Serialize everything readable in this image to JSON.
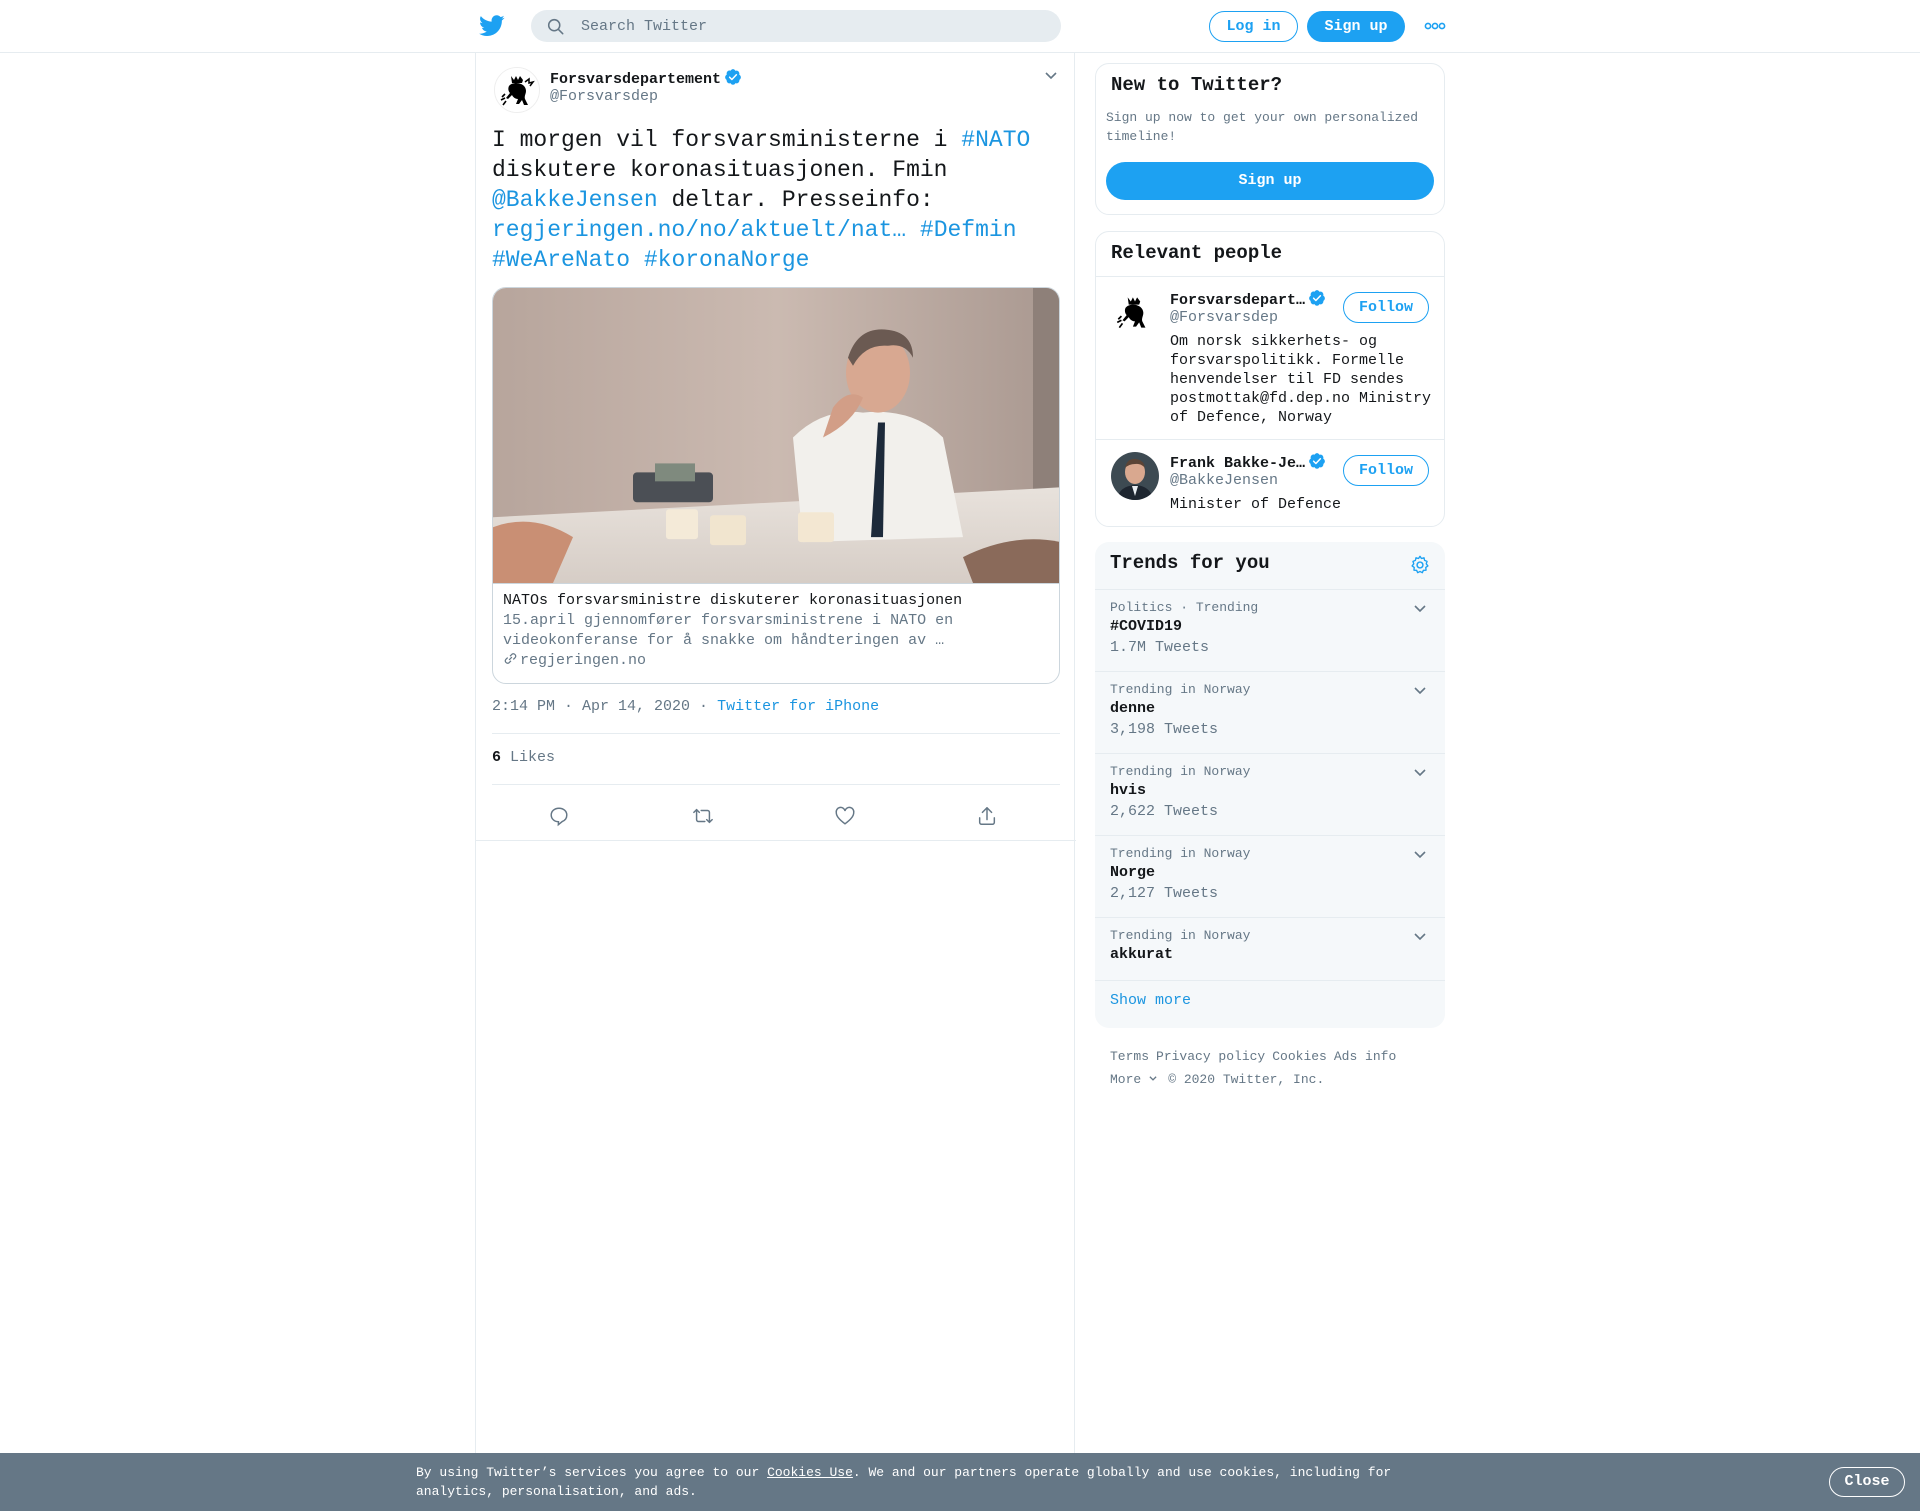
{
  "header": {
    "search_placeholder": "Search Twitter",
    "login_label": "Log in",
    "signup_label": "Sign up",
    "logo_icon": "twitter-bird-icon",
    "more_icon": "more-dots-icon",
    "brand_color": "#1da1f2"
  },
  "tweet": {
    "author_name": "Forsvarsdepartement",
    "author_handle": "@Forsvarsdep",
    "text_parts": {
      "t1": "I morgen vil forsvarsministerne i ",
      "nato": "#NATO",
      "t2": " diskutere koronasituasjonen. Fmin ",
      "mention": "@BakkeJensen",
      "t3": " deltar. Presseinfo: ",
      "link": "regjeringen.no/no/aktuelt/nat…",
      "defmin": "#Defmin",
      "wearenato": "#WeAreNato",
      "korona": "#koronaNorge"
    },
    "card": {
      "title": "NATOs forsvarsministre diskuterer koronasituasjonen",
      "description": "15.april gjennomfører forsvarsministrene i NATO en videokonferanse for å snakke om håndteringen av …",
      "domain": "regjeringen.no"
    },
    "time": "2:14 PM · Apr 14, 2020",
    "sep": " · ",
    "source": "Twitter for iPhone",
    "likes_count": "6",
    "likes_label": "Likes"
  },
  "sidebar": {
    "new_title": "New to Twitter?",
    "new_subtitle": "Sign up now to get your own personalized timeline!",
    "signup_label": "Sign up",
    "relevant_title": "Relevant people",
    "people": [
      {
        "name": "Forsvarsdepart…",
        "handle": "@Forsvarsdep",
        "bio": "Om norsk sikkerhets- og forsvarspolitikk. Formelle henvendelser til FD sendes postmottak@fd.dep.no Ministry of Defence, Norway",
        "follow_label": "Follow"
      },
      {
        "name": "Frank Bakke-Je…",
        "handle": "@BakkeJensen",
        "bio": "Minister of Defence",
        "follow_label": "Follow"
      }
    ],
    "trends_title": "Trends for you",
    "trends": [
      {
        "context": "Politics · Trending",
        "name": "#COVID19",
        "count": "1.7M Tweets"
      },
      {
        "context": "Trending in Norway",
        "name": "denne",
        "count": "3,198 Tweets"
      },
      {
        "context": "Trending in Norway",
        "name": "hvis",
        "count": "2,622 Tweets"
      },
      {
        "context": "Trending in Norway",
        "name": "Norge",
        "count": "2,127 Tweets"
      },
      {
        "context": "Trending in Norway",
        "name": "akkurat",
        "count": ""
      }
    ],
    "show_more": "Show more",
    "footer": {
      "terms": "Terms",
      "privacy": "Privacy policy",
      "cookies": "Cookies",
      "ads": "Ads info",
      "more": "More",
      "copyright": "© 2020 Twitter, Inc."
    }
  },
  "cookie_bar": {
    "text_before": "By using Twitter’s services you agree to our ",
    "link": "Cookies Use",
    "text_after": ". We and our partners operate globally and use cookies, including for analytics, personalisation, and ads.",
    "close_label": "Close"
  }
}
